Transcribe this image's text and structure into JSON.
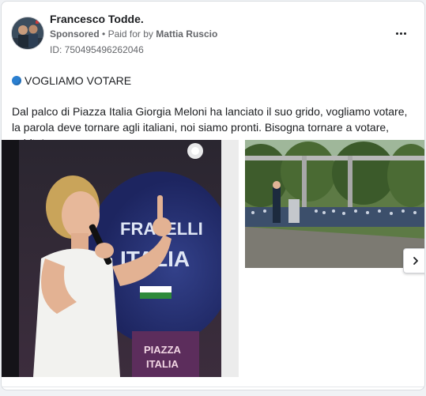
{
  "post": {
    "page_name": "Francesco Todde.",
    "sponsored": "Sponsored",
    "separator": "•",
    "paid_for_prefix": "Paid for by",
    "paid_for_name": "Mattia Ruscio",
    "ad_id": "ID: 750495496262046",
    "headline": "VOGLIAMO VOTARE",
    "body": "Dal palco di Piazza Italia Giorgia Meloni ha lanciato il suo grido, vogliamo votare, la parola deve tornare agli italiani, noi siamo pronti. Bisogna tornare a votare, subito!"
  },
  "icons": {
    "menu": "more-horizontal-icon",
    "headline_bullet": "blue-circle-icon",
    "next": "chevron-right-icon"
  },
  "colors": {
    "card_bg": "#ffffff",
    "page_bg": "#f0f2f5",
    "secondary_text": "#65676b",
    "bullet_blue": "#2b7fd0"
  }
}
